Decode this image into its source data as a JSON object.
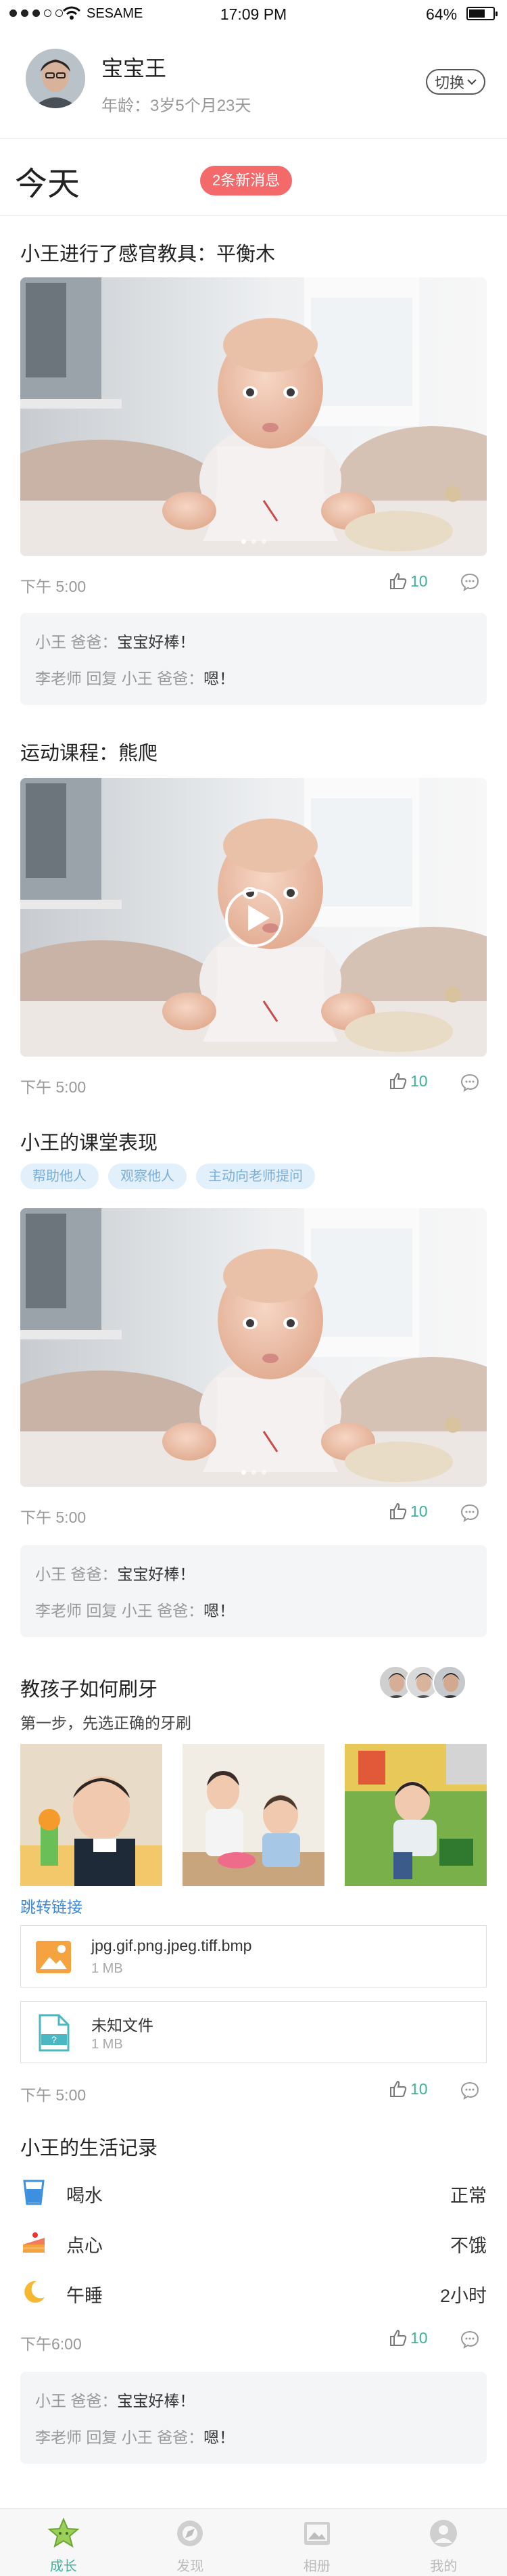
{
  "status_bar": {
    "carrier": "SESAME",
    "time": "17:09 PM",
    "battery": "64%",
    "battery_level": 0.64
  },
  "profile": {
    "name": "宝宝王",
    "age": "年龄：3岁5个月23天",
    "switch_label": "切换"
  },
  "today": {
    "title": "今天",
    "badge": "2条新消息"
  },
  "posts": [
    {
      "title": "小王进行了感官教具：平衡木",
      "time": "下午 5:00",
      "likes": "10",
      "comments": [
        {
          "author": "小王 爸爸：",
          "text": "宝宝好棒！"
        },
        {
          "author": "李老师 回复 小王 爸爸：",
          "text": "嗯！"
        }
      ]
    },
    {
      "title": "运动课程：熊爬",
      "time": "下午 5:00",
      "likes": "10"
    },
    {
      "title": "小王的课堂表现",
      "tags": [
        "帮助他人",
        "观察他人",
        "主动向老师提问"
      ],
      "time": "下午 5:00",
      "likes": "10",
      "comments": [
        {
          "author": "小王 爸爸：",
          "text": "宝宝好棒！"
        },
        {
          "author": "李老师 回复 小王 爸爸：",
          "text": "嗯！"
        }
      ]
    },
    {
      "title": "教孩子如何刷牙",
      "subtitle": "第一步，先选正确的牙刷",
      "link": "跳转链接",
      "files": [
        {
          "name": "jpg.gif.png.jpeg.tiff.bmp",
          "size": "1 MB",
          "icon": "image-file-icon"
        },
        {
          "name": "未知文件",
          "size": "1 MB",
          "icon": "unknown-file-icon"
        }
      ],
      "time": "下午 5:00",
      "likes": "10"
    },
    {
      "title": "小王的生活记录",
      "records": [
        {
          "label": "喝水",
          "value": "正常",
          "icon": "water-cup-icon"
        },
        {
          "label": "点心",
          "value": "不饿",
          "icon": "cake-icon"
        },
        {
          "label": "午睡",
          "value": "2小时",
          "icon": "moon-icon"
        }
      ],
      "time": "下午6:00",
      "likes": "10",
      "comments": [
        {
          "author": "小王 爸爸：",
          "text": "宝宝好棒！"
        },
        {
          "author": "李老师 回复 小王 爸爸：",
          "text": "嗯！"
        }
      ]
    }
  ],
  "tabbar": [
    {
      "label": "成长",
      "icon": "star-icon",
      "active": true
    },
    {
      "label": "发现",
      "icon": "discover-icon",
      "active": false
    },
    {
      "label": "相册",
      "icon": "album-icon",
      "active": false
    },
    {
      "label": "我的",
      "icon": "profile-icon",
      "active": false
    }
  ],
  "colors": {
    "accent": "#3bb29a",
    "badge": "#f46a6a",
    "link": "#3a86d6",
    "tag_bg": "#e2f0fb"
  }
}
